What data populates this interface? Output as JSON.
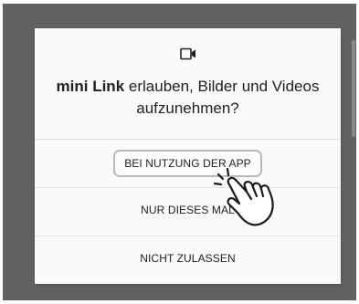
{
  "dialog": {
    "icon": "video-camera-icon",
    "title_app": "mini Link",
    "title_rest": "erlauben, Bilder und Videos aufzunehmen?",
    "options": [
      {
        "label": "BEI NUTZUNG DER APP",
        "highlighted": true
      },
      {
        "label": "NUR DIESES MAL"
      },
      {
        "label": "NICHT ZULASSEN"
      }
    ]
  },
  "overlay": {
    "pointer": "tapping-hand-icon"
  },
  "colors": {
    "scrim": "#616161",
    "dialog_bg": "#fafafa",
    "text": "#212121",
    "divider": "#e0e0e0",
    "highlight_border": "#b9b9b9"
  }
}
